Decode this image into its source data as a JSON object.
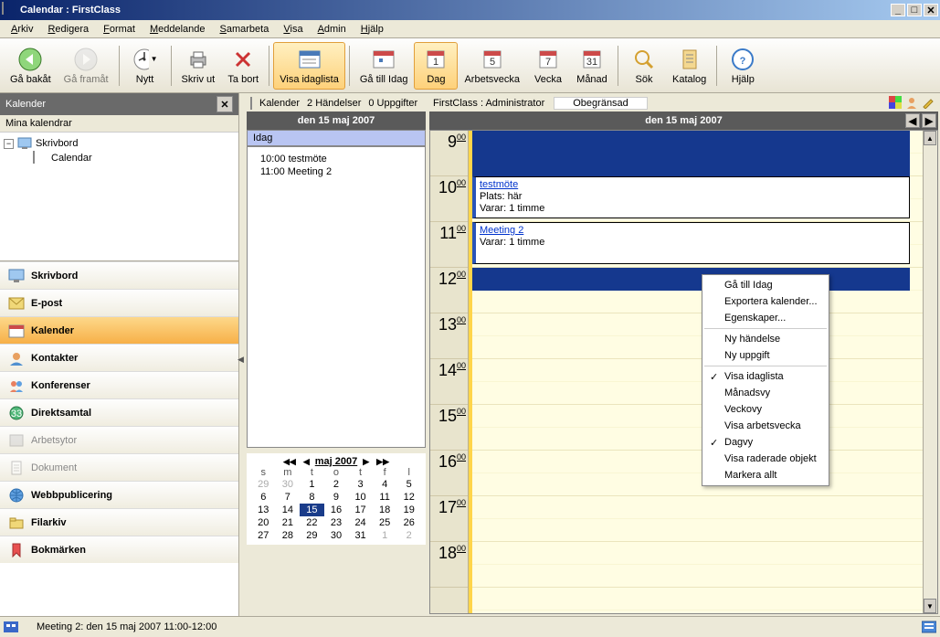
{
  "title": "Calendar : FirstClass",
  "menu": [
    "Arkiv",
    "Redigera",
    "Format",
    "Meddelande",
    "Samarbeta",
    "Visa",
    "Admin",
    "Hjälp"
  ],
  "toolbar": {
    "back": "Gå bakåt",
    "forward": "Gå framåt",
    "new": "Nytt",
    "print": "Skriv ut",
    "delete": "Ta bort",
    "daylist": "Visa idaglista",
    "gotoday": "Gå till Idag",
    "day": "Dag",
    "workweek": "Arbetsvecka",
    "week": "Vecka",
    "month": "Månad",
    "search": "Sök",
    "catalog": "Katalog",
    "help": "Hjälp"
  },
  "sidebar": {
    "title": "Kalender",
    "subtitle": "Mina kalendrar",
    "tree": {
      "root": "Skrivbord",
      "child": "Calendar"
    },
    "nav": [
      {
        "label": "Skrivbord"
      },
      {
        "label": "E-post"
      },
      {
        "label": "Kalender",
        "active": true
      },
      {
        "label": "Kontakter"
      },
      {
        "label": "Konferenser"
      },
      {
        "label": "Direktsamtal"
      },
      {
        "label": "Arbetsytor",
        "dim": true
      },
      {
        "label": "Dokument",
        "dim": true
      },
      {
        "label": "Webbpublicering"
      },
      {
        "label": "Filarkiv"
      },
      {
        "label": "Bokmärken"
      }
    ]
  },
  "info_bar": {
    "cal": "Kalender",
    "events": "2 Händelser",
    "tasks": "0 Uppgifter",
    "user": "FirstClass : Administrator",
    "quota": "Obegränsad"
  },
  "list_col": {
    "date": "den 15 maj 2007",
    "today": "Idag",
    "events": [
      "10:00 testmöte",
      "11:00 Meeting 2"
    ]
  },
  "mini_cal": {
    "month": "maj 2007",
    "dow": [
      "s",
      "m",
      "t",
      "o",
      "t",
      "f",
      "l"
    ],
    "rows": [
      [
        "29",
        "30",
        "1",
        "2",
        "3",
        "4",
        "5"
      ],
      [
        "6",
        "7",
        "8",
        "9",
        "10",
        "11",
        "12"
      ],
      [
        "13",
        "14",
        "15",
        "16",
        "17",
        "18",
        "19"
      ],
      [
        "20",
        "21",
        "22",
        "23",
        "24",
        "25",
        "26"
      ],
      [
        "27",
        "28",
        "29",
        "30",
        "31",
        "1",
        "2"
      ]
    ],
    "other_first": 2,
    "other_last": 2,
    "selected": "15"
  },
  "day_col": {
    "date": "den 15 maj 2007",
    "hours": [
      "9",
      "10",
      "11",
      "12",
      "13",
      "14",
      "15",
      "16",
      "17",
      "18"
    ],
    "appts": [
      {
        "hour": "10",
        "title": "testmöte",
        "lines": [
          "Plats: här",
          "Varar: 1 timme"
        ]
      },
      {
        "hour": "11",
        "title": "Meeting 2",
        "lines": [
          "Varar: 1 timme"
        ]
      }
    ],
    "selected_hour": "12"
  },
  "context_menu": [
    {
      "label": "Gå till Idag"
    },
    {
      "label": "Exportera kalender..."
    },
    {
      "label": "Egenskaper..."
    },
    {
      "sep": true
    },
    {
      "label": "Ny händelse"
    },
    {
      "label": "Ny uppgift"
    },
    {
      "sep": true
    },
    {
      "label": "Visa idaglista",
      "checked": true
    },
    {
      "label": "Månadsvy"
    },
    {
      "label": "Veckovy"
    },
    {
      "label": "Visa arbetsvecka"
    },
    {
      "label": "Dagvy",
      "checked": true
    },
    {
      "label": "Visa raderade objekt"
    },
    {
      "label": "Markera allt"
    }
  ],
  "status": "Meeting 2: den 15 maj 2007 11:00-12:00"
}
